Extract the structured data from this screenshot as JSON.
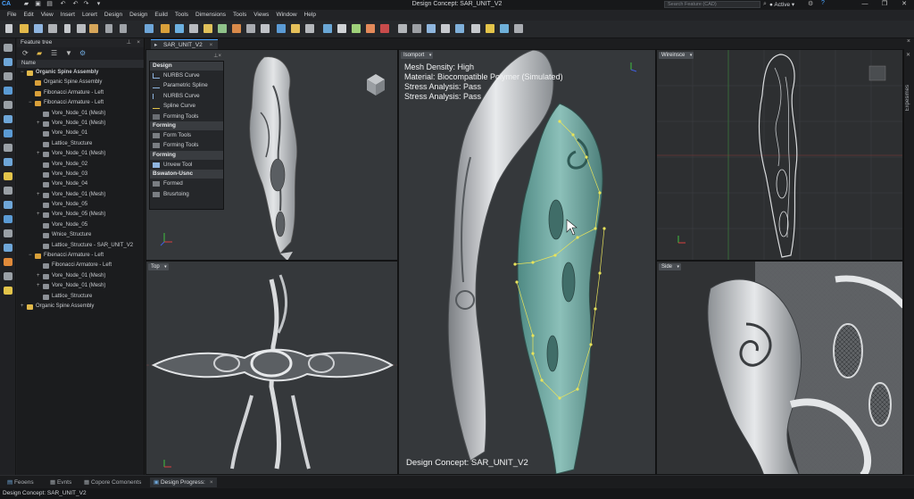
{
  "app": {
    "title": "Design Concept: SAR_UNIT_V2",
    "logo": "CA",
    "search_placeholder": "Search Feature (CAD)",
    "user_status": "Active"
  },
  "menu": [
    "File",
    "Edit",
    "View",
    "Insert",
    "Lorert",
    "Design",
    "Design",
    "Euild",
    "Tools",
    "Dimensions",
    "Tools",
    "Views",
    "Window",
    "Help"
  ],
  "document_tab": "SAR_UNIT_V2",
  "feature_tree": {
    "title": "Feature tree",
    "column": "Name",
    "items": [
      {
        "label": "Organic Spine Assembly",
        "level": 0,
        "expand": "−",
        "bold": true
      },
      {
        "label": "Organic Spine Assembly",
        "level": 1,
        "expand": "",
        "bold": false
      },
      {
        "label": "Fibonacci Armature - Left",
        "level": 1,
        "expand": "",
        "bold": false
      },
      {
        "label": "Fibonacci Armature - Left",
        "level": 1,
        "expand": "−",
        "bold": false
      },
      {
        "label": "Vore_Node_01 (Mesh)",
        "level": 2,
        "expand": "",
        "bold": false
      },
      {
        "label": "Vore_Node_01 (Mesh)",
        "level": 2,
        "expand": "+",
        "bold": false
      },
      {
        "label": "Vore_Node_01",
        "level": 2,
        "expand": "",
        "bold": false
      },
      {
        "label": "Lattice_Structure",
        "level": 2,
        "expand": "",
        "bold": false
      },
      {
        "label": "Vore_Node_01 (Mesh)",
        "level": 2,
        "expand": "+",
        "bold": false
      },
      {
        "label": "Vore_Node_02",
        "level": 2,
        "expand": "",
        "bold": false
      },
      {
        "label": "Vore_Node_03",
        "level": 2,
        "expand": "",
        "bold": false
      },
      {
        "label": "Vore_Node_04",
        "level": 2,
        "expand": "",
        "bold": false
      },
      {
        "label": "Vore_Nede_01 (Mesh)",
        "level": 2,
        "expand": "+",
        "bold": false
      },
      {
        "label": "Vore_Node_05",
        "level": 2,
        "expand": "",
        "bold": false
      },
      {
        "label": "Vore_Node_05 (Mesh)",
        "level": 2,
        "expand": "+",
        "bold": false
      },
      {
        "label": "Vore_Node_05",
        "level": 2,
        "expand": "",
        "bold": false
      },
      {
        "label": "Wnice_Structure",
        "level": 2,
        "expand": "",
        "bold": false
      },
      {
        "label": "Lattice_Structure -  SAR_UNIT_V2",
        "level": 2,
        "expand": "",
        "bold": false
      },
      {
        "label": "Fibenacci Armature - Left",
        "level": 1,
        "expand": "−",
        "bold": false
      },
      {
        "label": "Fibonacci Armatore - Left",
        "level": 2,
        "expand": "",
        "bold": false
      },
      {
        "label": "Vore_Node_01 (Mesh)",
        "level": 2,
        "expand": "+",
        "bold": false
      },
      {
        "label": "Vore_Node_01 (Mesh)",
        "level": 2,
        "expand": "+",
        "bold": false
      },
      {
        "label": "Lattice_Structure",
        "level": 2,
        "expand": "",
        "bold": false
      },
      {
        "label": "Organic Spine Assembly",
        "level": 0,
        "expand": "+",
        "bold": false
      }
    ]
  },
  "design_palette": {
    "sections": [
      {
        "title": "Design",
        "items": [
          "NURBS Curve",
          "Parametric Spline",
          "NURBS Curve",
          "Spline Curve",
          "Forming Tools"
        ]
      },
      {
        "title": "Forming",
        "items": [
          "Form Tools",
          "Forming Tools"
        ]
      },
      {
        "title": "Forming",
        "items": [
          "Unvew Tool"
        ]
      },
      {
        "title": "Bswaton-Usnc",
        "items": [
          "Formed",
          "Brusrtoing"
        ]
      }
    ]
  },
  "viewports": {
    "top_label": "Top",
    "iso_label": "Isomport",
    "wire_label": "Wireinsce",
    "side_label": "Side"
  },
  "overlay": {
    "lines": [
      "Mesh Density: High",
      "Material: Biocompatible Polymer (Simulated)",
      "Stress Analysis: Pass",
      "Stress Analysis: Pass"
    ],
    "caption": "Design Concept: SAR_UNIT_V2"
  },
  "right_panel": "Expesimes",
  "bottom_tabs": [
    "Feoens",
    "Evnts",
    "Copore Comonents",
    "Design Progress:"
  ],
  "status": "Design Concept: SAR_UNIT_V2",
  "colors": {
    "accent": "#4aa3ff",
    "mesh_teal": "#6fa6a0",
    "control_points": "#e8e35a",
    "background": "#35383b"
  }
}
